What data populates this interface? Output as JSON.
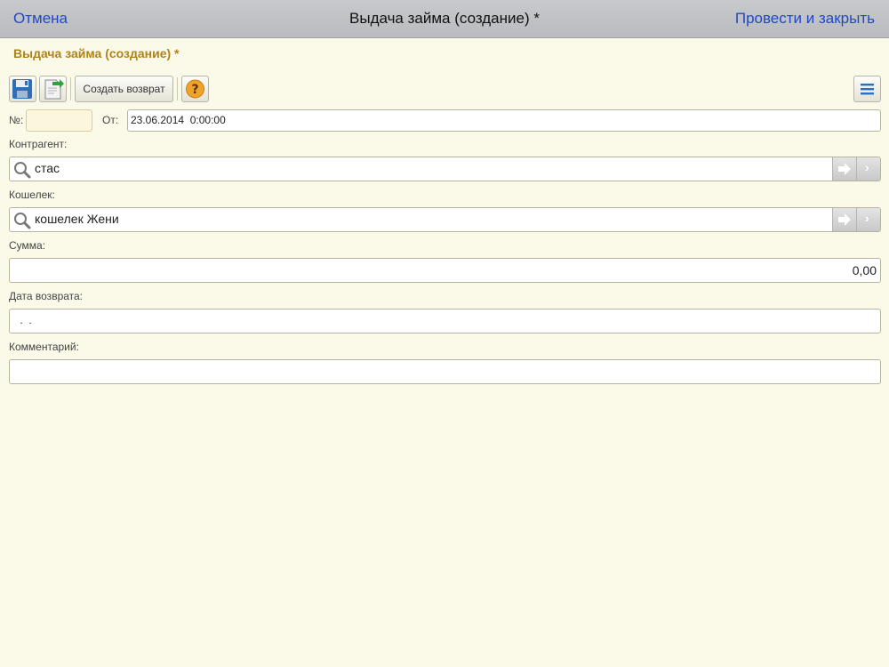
{
  "navbar": {
    "cancel": "Отмена",
    "title": "Выдача займа (создание) *",
    "post_close": "Провести и закрыть"
  },
  "form": {
    "title": "Выдача займа (создание) *"
  },
  "toolbar": {
    "create_return": "Создать возврат"
  },
  "header_fields": {
    "number_label": "№:",
    "number_value": "",
    "date_label": "От:",
    "date_value": "23.06.2014  0:00:00"
  },
  "counterparty": {
    "label": "Контрагент:",
    "value": "стас"
  },
  "wallet": {
    "label": "Кошелек:",
    "value": "кошелек Жени"
  },
  "amount": {
    "label": "Сумма:",
    "value": "0,00"
  },
  "return_date": {
    "label": "Дата возврата:",
    "value": " .  ."
  },
  "comment": {
    "label": "Комментарий:",
    "value": ""
  },
  "colors": {
    "background": "#fbfae9",
    "accent_link": "#2148c4",
    "form_title": "#b0831a"
  }
}
